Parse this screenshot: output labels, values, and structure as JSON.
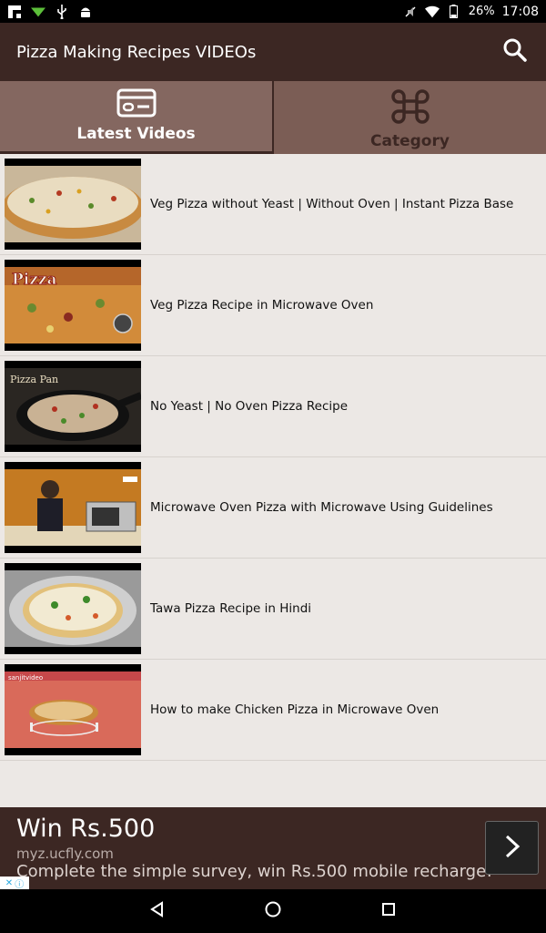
{
  "status_bar": {
    "battery": "26%",
    "time": "17:08",
    "icons_left": [
      "flipboard-icon",
      "wifi-download-icon",
      "usb-icon",
      "android-icon"
    ],
    "icons_right": [
      "mute-icon",
      "wifi-icon",
      "battery-icon"
    ]
  },
  "app_bar": {
    "title": "Pizza Making Recipes VIDEOs",
    "search_icon": "search-icon"
  },
  "tabs": [
    {
      "label": "Latest Videos",
      "icon": "video-card-icon",
      "active": true
    },
    {
      "label": "Category",
      "icon": "command-key-icon",
      "active": false
    }
  ],
  "videos": [
    {
      "title": "Veg Pizza without Yeast | Without Oven | Instant Pizza Base"
    },
    {
      "title": "Veg Pizza Recipe in Microwave Oven",
      "thumb_text": "Pizza"
    },
    {
      "title": "No Yeast | No Oven Pizza Recipe",
      "thumb_text": "Pizza Pan"
    },
    {
      "title": "Microwave Oven Pizza with Microwave Using Guidelines"
    },
    {
      "title": "Tawa Pizza Recipe in Hindi"
    },
    {
      "title": "How to make Chicken Pizza in Microwave Oven",
      "thumb_text": "sanjitvideo"
    }
  ],
  "ad": {
    "headline": "Win Rs.500",
    "url": "myz.ucfly.com",
    "description": "Complete the simple survey, win Rs.500 mobile recharge!",
    "arrow_icon": "chevron-right-icon",
    "choices_icon": "ad-choices-icon"
  },
  "nav_bar": {
    "buttons": [
      "back-icon",
      "home-icon",
      "recents-icon"
    ]
  },
  "colors": {
    "app_bar": "#3c2723",
    "tabs": "#7b5d55",
    "list_background": "#ece8e5"
  }
}
